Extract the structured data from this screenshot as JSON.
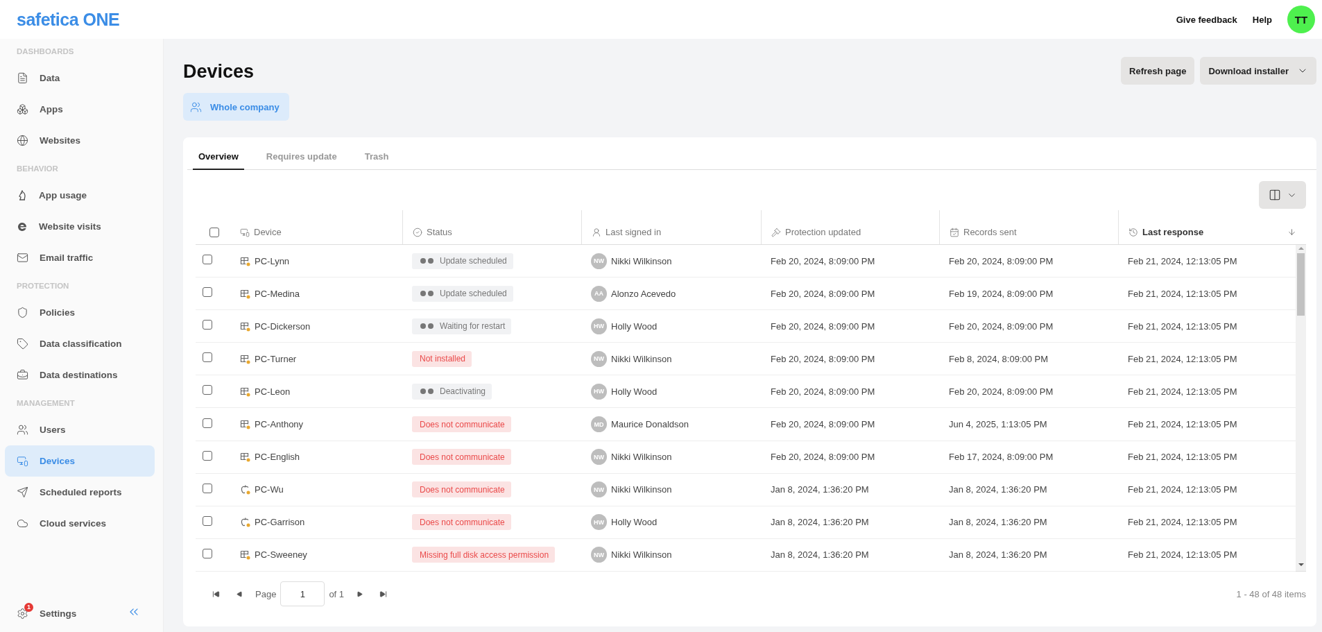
{
  "topbar": {
    "logo": "safetica ONE",
    "links": [
      "Give feedback",
      "Help"
    ],
    "avatar": {
      "initials": "TT"
    }
  },
  "sidebar": {
    "sections": [
      {
        "title": "DASHBOARDS",
        "items": [
          {
            "label": "Data",
            "selected": false
          },
          {
            "label": "Apps",
            "selected": false
          },
          {
            "label": "Websites",
            "selected": false
          }
        ]
      },
      {
        "title": "BEHAVIOR",
        "items": [
          {
            "label": "App usage",
            "selected": false
          },
          {
            "label": "Website visits",
            "selected": false
          },
          {
            "label": "Email traffic",
            "selected": false
          }
        ]
      },
      {
        "title": "PROTECTION",
        "items": [
          {
            "label": "Policies",
            "selected": false
          },
          {
            "label": "Data classification",
            "selected": false
          },
          {
            "label": "Data destinations",
            "selected": false
          }
        ]
      },
      {
        "title": "MANAGEMENT",
        "items": [
          {
            "label": "Users",
            "selected": false
          },
          {
            "label": "Devices",
            "selected": true
          },
          {
            "label": "Scheduled reports",
            "selected": false
          },
          {
            "label": "Cloud services",
            "selected": false
          }
        ]
      }
    ],
    "settings": {
      "label": "Settings",
      "badge": "1"
    }
  },
  "page": {
    "title": "Devices",
    "buttons": [
      {
        "label": "Refresh page",
        "dropdown": false
      },
      {
        "label": "Download installer",
        "dropdown": true
      }
    ],
    "scope": "Whole company"
  },
  "tabs": [
    {
      "label": "Overview",
      "selected": true
    },
    {
      "label": "Requires update",
      "selected": false
    },
    {
      "label": "Trash",
      "selected": false
    }
  ],
  "table": {
    "header_checked": false,
    "columns": [
      {
        "label": "Device",
        "sorted": false
      },
      {
        "label": "Status",
        "sorted": false
      },
      {
        "label": "Last signed in",
        "sorted": false
      },
      {
        "label": "Protection updated",
        "sorted": false
      },
      {
        "label": "Records sent",
        "sorted": false
      },
      {
        "label": "Last response",
        "sorted": true
      }
    ],
    "rows": [
      {
        "checked": false,
        "kind": "windows",
        "device": "PC-Lynn",
        "status": {
          "kind": "pending",
          "text": "Update scheduled"
        },
        "user": {
          "initials": "NW",
          "name": "Nikki Wilkinson"
        },
        "protection_updated": "Feb 20, 2024, 8:09:00 PM",
        "records_sent": "Feb 20, 2024, 8:09:00 PM",
        "last_response": "Feb 21, 2024, 12:13:05 PM"
      },
      {
        "checked": false,
        "kind": "windows",
        "device": "PC-Medina",
        "status": {
          "kind": "pending",
          "text": "Update scheduled"
        },
        "user": {
          "initials": "AA",
          "name": "Alonzo Acevedo"
        },
        "protection_updated": "Feb 20, 2024, 8:09:00 PM",
        "records_sent": "Feb 19, 2024, 8:09:00 PM",
        "last_response": "Feb 21, 2024, 12:13:05 PM"
      },
      {
        "checked": false,
        "kind": "windows",
        "device": "PC-Dickerson",
        "status": {
          "kind": "pending",
          "text": "Waiting for restart"
        },
        "user": {
          "initials": "HW",
          "name": "Holly Wood"
        },
        "protection_updated": "Feb 20, 2024, 8:09:00 PM",
        "records_sent": "Feb 20, 2024, 8:09:00 PM",
        "last_response": "Feb 21, 2024, 12:13:05 PM"
      },
      {
        "checked": false,
        "kind": "windows",
        "device": "PC-Turner",
        "status": {
          "kind": "error",
          "text": "Not installed"
        },
        "user": {
          "initials": "NW",
          "name": "Nikki Wilkinson"
        },
        "protection_updated": "Feb 20, 2024, 8:09:00 PM",
        "records_sent": "Feb 8, 2024, 8:09:00 PM",
        "last_response": "Feb 21, 2024, 12:13:05 PM"
      },
      {
        "checked": false,
        "kind": "windows",
        "device": "PC-Leon",
        "status": {
          "kind": "pending",
          "text": "Deactivating"
        },
        "user": {
          "initials": "HW",
          "name": "Holly Wood"
        },
        "protection_updated": "Feb 20, 2024, 8:09:00 PM",
        "records_sent": "Feb 20, 2024, 8:09:00 PM",
        "last_response": "Feb 21, 2024, 12:13:05 PM"
      },
      {
        "checked": false,
        "kind": "windows",
        "device": "PC-Anthony",
        "status": {
          "kind": "error",
          "text": "Does not communicate"
        },
        "user": {
          "initials": "MD",
          "name": "Maurice Donaldson"
        },
        "protection_updated": "Feb 20, 2024, 8:09:00 PM",
        "records_sent": "Jun 4, 2025, 1:13:05 PM",
        "last_response": "Feb 21, 2024, 12:13:05 PM"
      },
      {
        "checked": false,
        "kind": "windows",
        "device": "PC-English",
        "status": {
          "kind": "error",
          "text": "Does not communicate"
        },
        "user": {
          "initials": "NW",
          "name": "Nikki Wilkinson"
        },
        "protection_updated": "Feb 20, 2024, 8:09:00 PM",
        "records_sent": "Feb 17, 2024, 8:09:00 PM",
        "last_response": "Feb 21, 2024, 12:13:05 PM"
      },
      {
        "checked": false,
        "kind": "apple",
        "device": "PC-Wu",
        "status": {
          "kind": "error",
          "text": "Does not communicate"
        },
        "user": {
          "initials": "NW",
          "name": "Nikki Wilkinson"
        },
        "protection_updated": "Jan 8, 2024, 1:36:20 PM",
        "records_sent": "Jan 8, 2024, 1:36:20 PM",
        "last_response": "Feb 21, 2024, 12:13:05 PM"
      },
      {
        "checked": false,
        "kind": "apple",
        "device": "PC-Garrison",
        "status": {
          "kind": "error",
          "text": "Does not communicate"
        },
        "user": {
          "initials": "HW",
          "name": "Holly Wood"
        },
        "protection_updated": "Jan 8, 2024, 1:36:20 PM",
        "records_sent": "Jan 8, 2024, 1:36:20 PM",
        "last_response": "Feb 21, 2024, 12:13:05 PM"
      },
      {
        "checked": false,
        "kind": "windows",
        "device": "PC-Sweeney",
        "status": {
          "kind": "error",
          "text": "Missing full disk access permission"
        },
        "user": {
          "initials": "NW",
          "name": "Nikki Wilkinson"
        },
        "protection_updated": "Jan 8, 2024, 1:36:20 PM",
        "records_sent": "Jan 8, 2024, 1:36:20 PM",
        "last_response": "Feb 21, 2024, 12:13:05 PM"
      }
    ]
  },
  "pagination": {
    "page_label": "Page",
    "page": "1",
    "of": "of 1",
    "summary": "1 - 48 of 48 items"
  }
}
